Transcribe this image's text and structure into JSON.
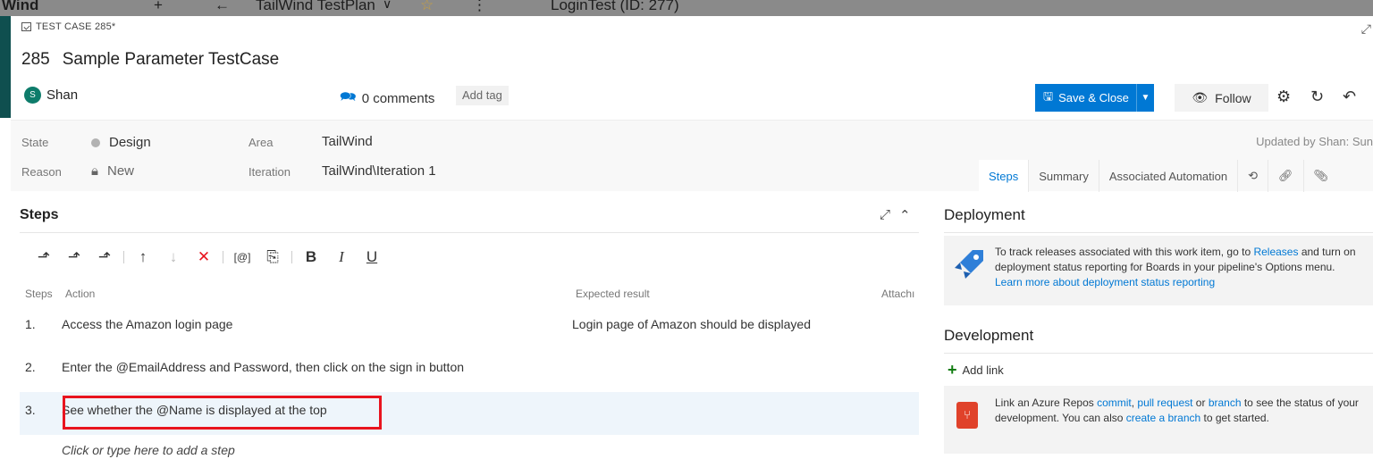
{
  "background": {
    "left_text": "Wind",
    "plan_name": "TailWind TestPlan",
    "suite_name": "LoginTest (ID: 277)"
  },
  "work_item": {
    "type_label": "TEST CASE 285*",
    "id": "285",
    "title": "Sample Parameter TestCase",
    "assignee": "Shan",
    "assignee_initial": "S",
    "comments_label": "0 comments",
    "add_tag": "Add tag"
  },
  "toolbar": {
    "save_label": "Save & Close",
    "follow_label": "Follow"
  },
  "fields": {
    "state_label": "State",
    "state_value": "Design",
    "reason_label": "Reason",
    "reason_value": "New",
    "area_label": "Area",
    "area_value": "TailWind",
    "iteration_label": "Iteration",
    "iteration_value": "TailWind\\Iteration 1",
    "updated": "Updated by Shan: Sun"
  },
  "tabs": [
    "Steps",
    "Summary",
    "Associated Automation"
  ],
  "steps": {
    "title": "Steps",
    "columns": {
      "steps": "Steps",
      "action": "Action",
      "expected": "Expected result",
      "attach": "Attachı"
    },
    "rows": [
      {
        "num": "1.",
        "action": "Access the Amazon login page",
        "expected": "Login page of Amazon should be displayed"
      },
      {
        "num": "2.",
        "action": "Enter the @EmailAddress and Password, then click on the sign in button",
        "expected": ""
      },
      {
        "num": "3.",
        "action": "See whether the  @Name is displayed at the top",
        "expected": ""
      }
    ],
    "add_step": "Click or type here to add a step"
  },
  "deployment": {
    "title": "Deployment",
    "text_1": "To track releases associated with this work item, go to ",
    "link_releases": "Releases",
    "text_2": " and turn on deployment status reporting for Boards in your pipeline's Options menu. ",
    "link_learn": "Learn more about deployment status reporting"
  },
  "development": {
    "title": "Development",
    "add_link": "Add link",
    "text_1": "Link an Azure Repos ",
    "link_commit": "commit",
    "sep_1": ", ",
    "link_pr": "pull request",
    "text_2": " or ",
    "link_branch": "branch",
    "text_3": " to see the status of your development. You can also ",
    "link_create": "create a branch",
    "text_4": " to get started."
  },
  "colors": {
    "accent": "#0078d4",
    "highlight_box": "#e8141e",
    "avatar": "#0e7c6b",
    "repo_icon": "#e0422a"
  }
}
